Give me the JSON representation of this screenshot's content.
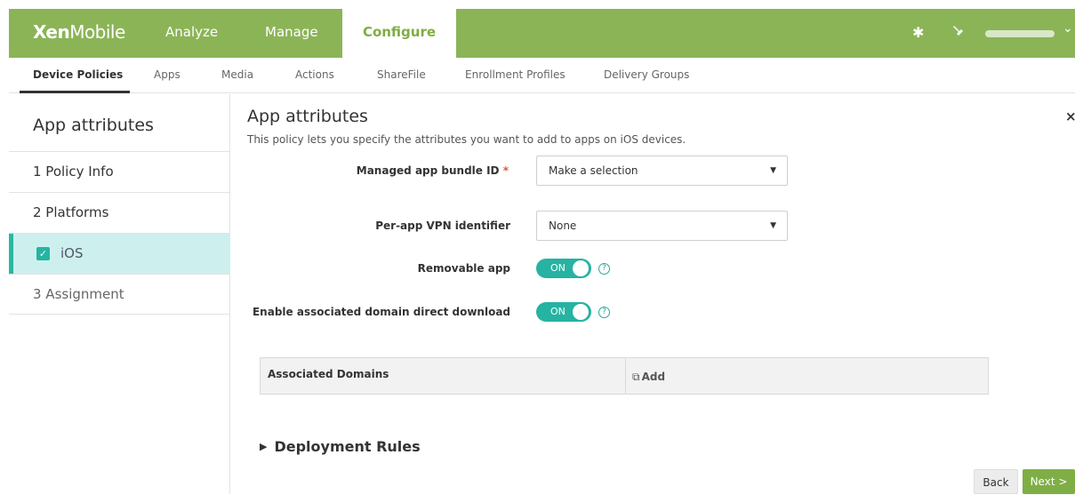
{
  "header": {
    "logo_bold": "Xen",
    "logo_light": "Mobile",
    "nav": [
      "Analyze",
      "Manage",
      "Configure"
    ],
    "active_nav": "Configure",
    "icons": [
      "gear-icon",
      "wrench-icon",
      "chevron-down-icon"
    ]
  },
  "subnav": {
    "items": [
      "Device Policies",
      "Apps",
      "Media",
      "Actions",
      "ShareFile",
      "Enrollment Profiles",
      "Delivery Groups"
    ],
    "active": "Device Policies"
  },
  "sidebar": {
    "title": "App attributes",
    "items": [
      {
        "label": "1 Policy Info"
      },
      {
        "label": "2 Platforms"
      },
      {
        "label": "iOS"
      },
      {
        "label": "3 Assignment"
      }
    ]
  },
  "main": {
    "title": "App attributes",
    "description": "This policy lets you specify the attributes you want to add to apps on iOS devices.",
    "fields": {
      "bundle_label": "Managed app bundle ID",
      "bundle_required": "*",
      "bundle_value": "Make a selection",
      "vpn_label": "Per-app VPN identifier",
      "vpn_value": "None",
      "removable_label": "Removable app",
      "removable_state": "ON",
      "domain_label": "Enable associated domain direct download",
      "domain_state": "ON",
      "help_glyph": "?"
    },
    "table": {
      "header": "Associated Domains",
      "add_label": "Add"
    },
    "deployment_rules": "Deployment Rules",
    "close_glyph": "×"
  },
  "footer": {
    "back": "Back",
    "next": "Next >"
  },
  "colors": {
    "accent_green": "#8bb457",
    "toggle_teal": "#26b3a1",
    "selected_bg": "#cdf0ee"
  }
}
